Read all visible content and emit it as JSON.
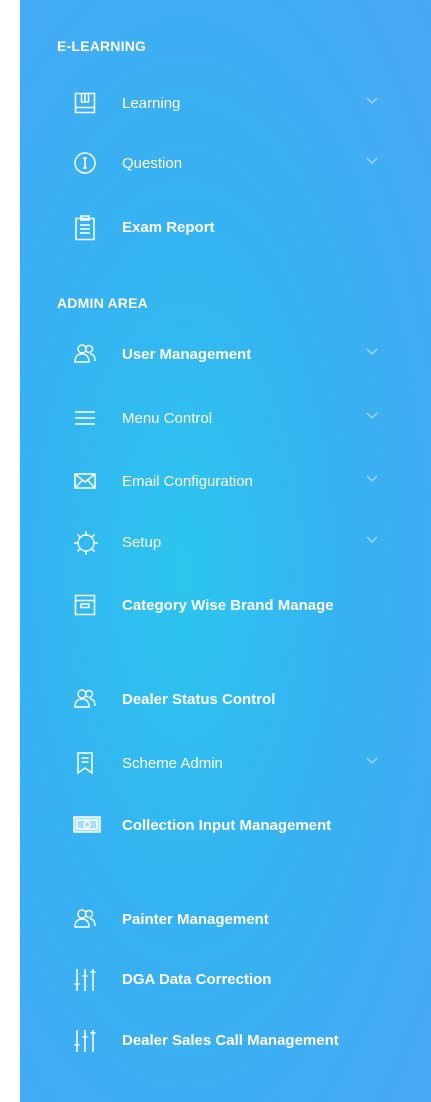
{
  "sidebar": {
    "sections": [
      {
        "title": "E-LEARNING",
        "items": [
          {
            "label": "Learning",
            "icon": "book-icon",
            "has_submenu": true
          },
          {
            "label": "Question",
            "icon": "info-circle-icon",
            "has_submenu": true
          },
          {
            "label": "Exam Report",
            "icon": "clipboard-icon",
            "has_submenu": false
          }
        ]
      },
      {
        "title": "ADMIN AREA",
        "items": [
          {
            "label": "User Management",
            "icon": "users-icon",
            "has_submenu": true
          },
          {
            "label": "Menu Control",
            "icon": "menu-lines-icon",
            "has_submenu": true
          },
          {
            "label": "Email Configuration",
            "icon": "envelope-icon",
            "has_submenu": true
          },
          {
            "label": "Setup",
            "icon": "gear-icon",
            "has_submenu": true
          },
          {
            "label": "Category Wise Brand Manage",
            "icon": "archive-box-icon",
            "has_submenu": false
          },
          {
            "label": "Dealer Status Control",
            "icon": "users-icon",
            "has_submenu": false
          },
          {
            "label": "Scheme Admin",
            "icon": "bookmark-list-icon",
            "has_submenu": true
          },
          {
            "label": "Collection Input Management",
            "icon": "money-icon",
            "has_submenu": false
          },
          {
            "label": "Painter Management",
            "icon": "users-icon",
            "has_submenu": false
          },
          {
            "label": "DGA Data Correction",
            "icon": "sliders-icon",
            "has_submenu": false
          },
          {
            "label": "Dealer Sales Call Management",
            "icon": "sliders-icon",
            "has_submenu": false
          }
        ]
      }
    ]
  },
  "colors": {
    "sidebar_gradient_center": "#2bc6ee",
    "sidebar_gradient_edge": "#4aa8f6",
    "text": "#ffffff"
  }
}
